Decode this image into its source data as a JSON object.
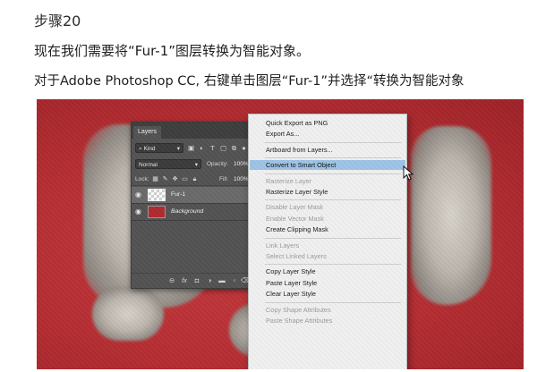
{
  "step_title": "步骤20",
  "instruction_1": "现在我们需要将“Fur-1”图层转换为智能对象。",
  "instruction_2": "对于Adobe Photoshop CC, 右键单击图层“Fur-1”并选择“转换为智能对象",
  "layers_panel": {
    "tab": "Layers",
    "kind_filter": "Kind",
    "blend_mode": "Normal",
    "opacity_label": "Opacity:",
    "opacity_value": "100%",
    "lock_label": "Lock:",
    "fill_label": "Fill:",
    "fill_value": "100%",
    "layers": [
      {
        "name": "Fur-1",
        "selected": true
      },
      {
        "name": "Background",
        "selected": false
      }
    ]
  },
  "context_menu": {
    "items": [
      {
        "label": "Quick Export as PNG",
        "state": "enabled"
      },
      {
        "label": "Export As...",
        "state": "enabled"
      },
      {
        "separator": true
      },
      {
        "label": "Artboard from Layers...",
        "state": "enabled"
      },
      {
        "separator": true
      },
      {
        "label": "Convert to Smart Object",
        "state": "highlighted"
      },
      {
        "separator": true
      },
      {
        "label": "Rasterize Layer",
        "state": "disabled"
      },
      {
        "label": "Rasterize Layer Style",
        "state": "enabled"
      },
      {
        "separator": true
      },
      {
        "label": "Disable Layer Mask",
        "state": "disabled"
      },
      {
        "label": "Enable Vector Mask",
        "state": "disabled"
      },
      {
        "label": "Create Clipping Mask",
        "state": "enabled"
      },
      {
        "separator": true
      },
      {
        "label": "Link Layers",
        "state": "disabled"
      },
      {
        "label": "Select Linked Layers",
        "state": "disabled"
      },
      {
        "separator": true
      },
      {
        "label": "Copy Layer Style",
        "state": "enabled"
      },
      {
        "label": "Paste Layer Style",
        "state": "enabled"
      },
      {
        "label": "Clear Layer Style",
        "state": "enabled"
      },
      {
        "separator": true
      },
      {
        "label": "Copy Shape Attributes",
        "state": "disabled"
      },
      {
        "label": "Paste Shape Attributes",
        "state": "disabled"
      }
    ]
  },
  "colors": {
    "canvas_red": "#b52d32",
    "panel_gray": "#535353",
    "menu_highlight": "#9ec4e6"
  }
}
